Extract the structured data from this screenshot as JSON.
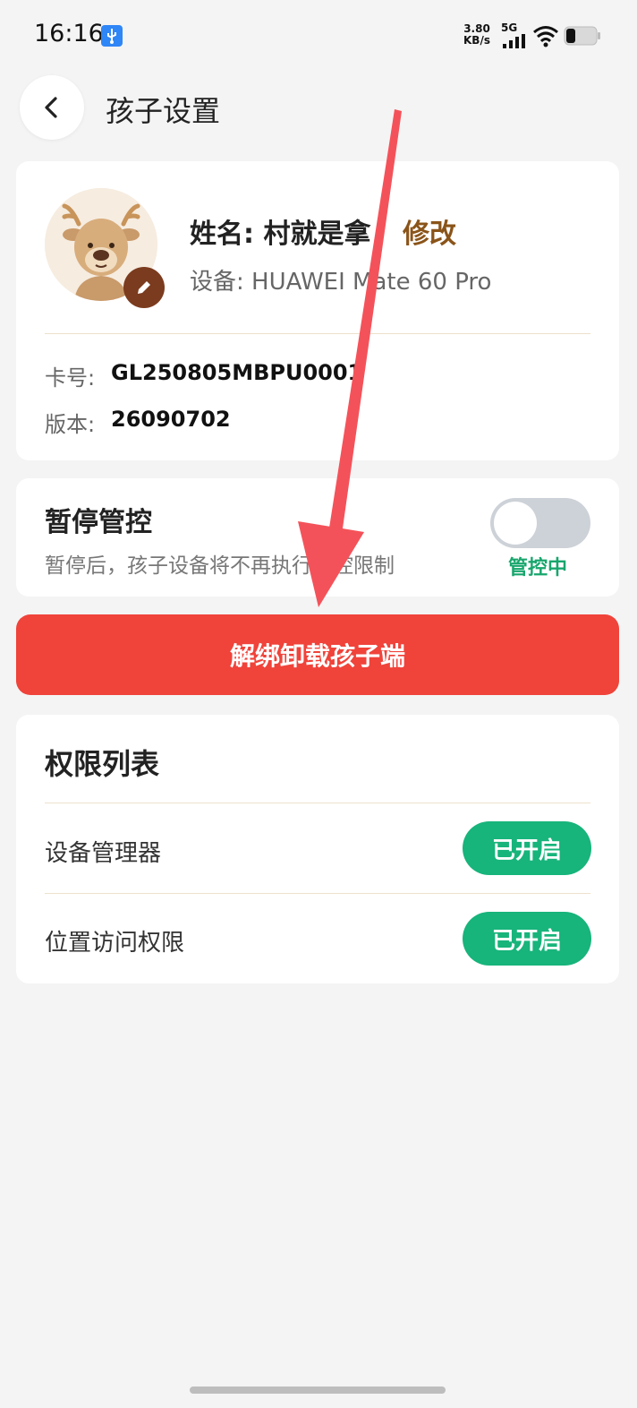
{
  "status_bar": {
    "time": "16:16",
    "net_speed_value": "3.80",
    "net_speed_unit": "KB/s",
    "network_type": "5G",
    "battery_level": 0.3
  },
  "header": {
    "title": "孩子设置"
  },
  "profile": {
    "name_label": "姓名: 村就是拿",
    "edit_link": "修改",
    "device": "设备: HUAWEI Mate 60 Pro",
    "card_label": "卡号:",
    "card_value": "GL250805MBPU0001",
    "version_label": "版本:",
    "version_value": "26090702"
  },
  "pause_control": {
    "title": "暂停管控",
    "description": "暂停后，孩子设备将不再执行管控限制",
    "toggle_on": false,
    "status": "管控中"
  },
  "unbind_button": {
    "label": "解绑卸载孩子端"
  },
  "permissions": {
    "title": "权限列表",
    "items": [
      {
        "label": "设备管理器",
        "status": "已开启"
      },
      {
        "label": "位置访问权限",
        "status": "已开启"
      }
    ]
  },
  "colors": {
    "accent_red": "#f0433a",
    "status_green": "#17b47b",
    "edit_brown": "#8a5419",
    "background": "#f4f4f4"
  }
}
